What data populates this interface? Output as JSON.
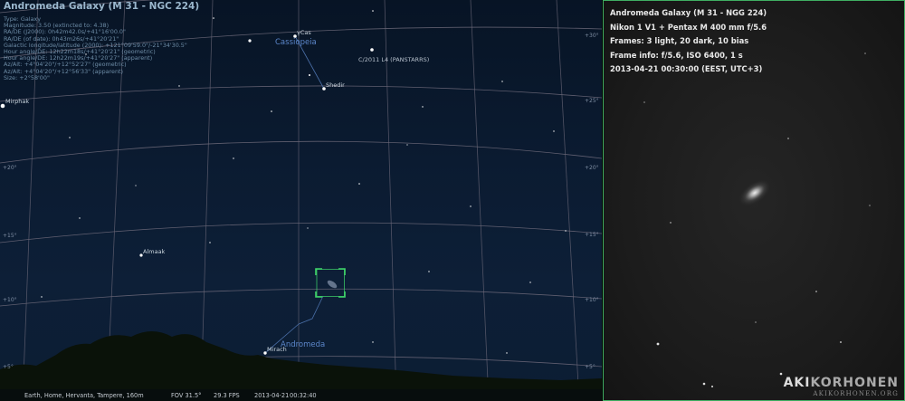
{
  "object_info": {
    "title": "Andromeda Galaxy (M 31 - NGC 224)",
    "rows": [
      "Type: Galaxy",
      "Magnitude: 3.50 (extincted to: 4.38)",
      "RA/DE (J2000): 0h42m42.0s/+41°16'00.0\"",
      "RA/DE (of date): 0h43m26s/+41°20'21\"",
      "Galactic longitude/latitude (2000): +121°09'59.0\"/-21°34'30.5\"",
      "Hour angle/DE: 12h22m18s/+41°20'21\" (geometric)",
      "Hour angle/DE: 12h22m19s/+41°20'27\" (apparent)",
      "Az/Alt: +4°04'20\"/+12°52'27\" (geometric)",
      "Az/Alt: +4°04'20\"/+12°56'33\" (apparent)",
      "Size: +2°58'00\""
    ]
  },
  "sky_labels": {
    "gamma_cas": "γCas",
    "cassiopeia": "Cassiopeia",
    "comet": "C/2011 L4 (PANSTARRS)",
    "shedir": "Shedir",
    "mirphak": "Mirphak",
    "almaak": "Almaak",
    "andromeda": "Andromeda",
    "mirach": "Mirach"
  },
  "grid_labels": {
    "l_20": "+20°",
    "l_15": "+15°",
    "l_10": "+10°",
    "l_5": "+5°",
    "r_30": "+30°",
    "r_25": "+25°",
    "r_20": "+20°",
    "r_15": "+15°",
    "r_10": "+10°",
    "r_5": "+5°"
  },
  "status_bar": {
    "location": "Earth, Home, Hervanta, Tampere, 160m",
    "fov": "FOV 31.5°",
    "fps": "29.3 FPS",
    "date": "2013-04-21",
    "time": "00:32:40"
  },
  "photo": {
    "lines": [
      "Andromeda Galaxy (M 31 - NGG 224)",
      "Nikon 1 V1 + Pentax M 400 mm f/5.6",
      "Frames: 3 light, 20 dark, 10 bias",
      "Frame info: f/5.6, ISO 6400, 1 s",
      "2013-04-21 00:30:00 (EEST, UTC+3)"
    ],
    "brand_a": "AKI",
    "brand_b": "KORHONEN",
    "brand_url": "AKIKORHONEN.ORG"
  },
  "colors": {
    "selection": "#3fd46a",
    "grid": "#6e6a7a",
    "constellation_line": "#4a6fa8",
    "photo_border": "#3fae62"
  }
}
